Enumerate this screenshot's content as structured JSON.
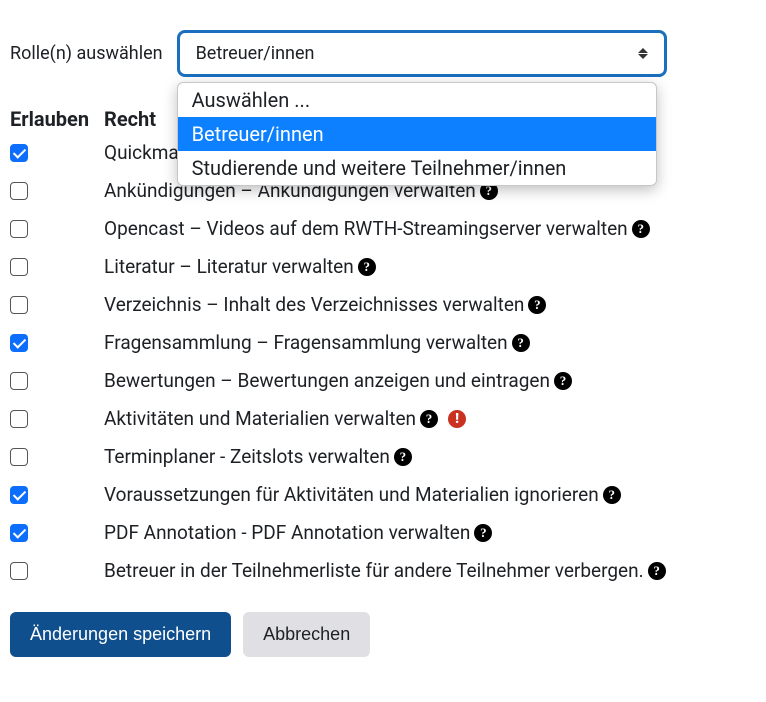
{
  "role_select": {
    "label": "Rolle(n) auswählen",
    "value": "Betreuer/innen",
    "options": [
      {
        "label": "Auswählen ...",
        "selected": false
      },
      {
        "label": "Betreuer/innen",
        "selected": true
      },
      {
        "label": "Studierende und weitere Teilnehmer/innen",
        "selected": false
      }
    ]
  },
  "table": {
    "header_allow": "Erlauben",
    "header_right": "Recht"
  },
  "permissions": [
    {
      "checked": true,
      "label": "Quickmail",
      "help": true,
      "risk": false
    },
    {
      "checked": false,
      "label": "Ankündigungen – Ankündigungen verwalten",
      "help": true,
      "risk": false
    },
    {
      "checked": false,
      "label": "Opencast – Videos auf dem RWTH-Streamingserver verwalten",
      "help": true,
      "risk": false
    },
    {
      "checked": false,
      "label": "Literatur – Literatur verwalten",
      "help": true,
      "risk": false
    },
    {
      "checked": false,
      "label": "Verzeichnis – Inhalt des Verzeichnisses verwalten",
      "help": true,
      "risk": false
    },
    {
      "checked": true,
      "label": "Fragensammlung – Fragensammlung verwalten",
      "help": true,
      "risk": false
    },
    {
      "checked": false,
      "label": "Bewertungen – Bewertungen anzeigen und eintragen",
      "help": true,
      "risk": false
    },
    {
      "checked": false,
      "label": "Aktivitäten und Materialien verwalten",
      "help": true,
      "risk": true
    },
    {
      "checked": false,
      "label": "Terminplaner - Zeitslots verwalten",
      "help": true,
      "risk": false
    },
    {
      "checked": true,
      "label": "Voraussetzungen für Aktivitäten und Materialien ignorieren",
      "help": true,
      "risk": false
    },
    {
      "checked": true,
      "label": "PDF Annotation - PDF Annotation verwalten",
      "help": true,
      "risk": false
    },
    {
      "checked": false,
      "label": "Betreuer in der Teilnehmerliste für andere Teilnehmer verbergen.",
      "help": true,
      "risk": false
    }
  ],
  "buttons": {
    "save": "Änderungen speichern",
    "cancel": "Abbrechen"
  }
}
